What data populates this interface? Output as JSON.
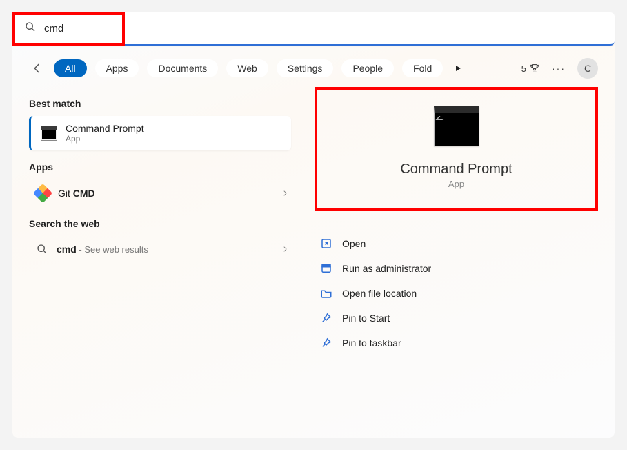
{
  "search": {
    "value": "cmd"
  },
  "filters": {
    "back": true,
    "tabs": [
      "All",
      "Apps",
      "Documents",
      "Web",
      "Settings",
      "People",
      "Fold"
    ],
    "active_index": 0,
    "rewards_count": "5",
    "avatar_letter": "C"
  },
  "sections": {
    "best_match_label": "Best match",
    "best_match": {
      "title": "Command Prompt",
      "subtitle": "App"
    },
    "apps_label": "Apps",
    "apps": {
      "prefix": "Git ",
      "bold": "CMD"
    },
    "web_label": "Search the web",
    "web": {
      "bold": "cmd",
      "suffix": " - See web results"
    }
  },
  "detail": {
    "title": "Command Prompt",
    "subtitle": "App",
    "actions": {
      "open": "Open",
      "run_admin": "Run as administrator",
      "open_loc": "Open file location",
      "pin_start": "Pin to Start",
      "pin_taskbar": "Pin to taskbar"
    }
  }
}
